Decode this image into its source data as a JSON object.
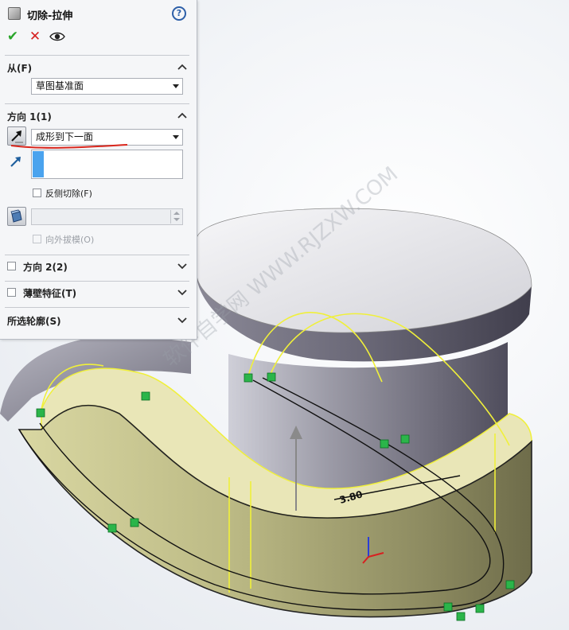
{
  "panel": {
    "title": "切除-拉伸",
    "help_icon": "help-icon",
    "help_glyph": "?",
    "actions": {
      "ok_glyph": "✔",
      "cancel_glyph": "✕",
      "preview_glyph": "👁"
    }
  },
  "from": {
    "label": "从(F)",
    "start_condition": "草图基准面"
  },
  "direction1": {
    "label": "方向 1(1)",
    "end_condition": "成形到下一面",
    "flip_side_to_cut": "反侧切除(F)",
    "draft_outward": "向外拔模(O)"
  },
  "direction2": {
    "label": "方向 2(2)"
  },
  "thin_feature": {
    "label": "薄壁特征(T)"
  },
  "selected_contours": {
    "label": "所选轮廓(S)"
  },
  "viewport": {
    "dimension_label": "3.80",
    "watermark": "软件自学网 WWW.RJZXW.COM"
  },
  "colors": {
    "accent": "#4aa3ee",
    "annotation": "#d9261c",
    "edge_highlight": "#f0f03a",
    "sketch_relation": "#2bb54a"
  }
}
